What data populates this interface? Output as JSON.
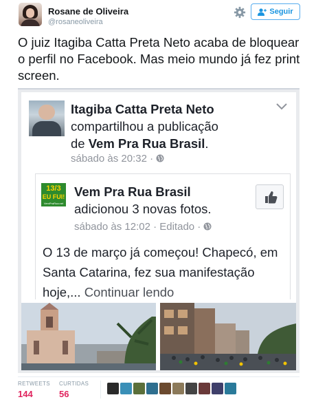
{
  "tweet": {
    "author_name": "Rosane de Oliveira",
    "author_handle": "@rosaneoliveira",
    "follow_label": "Seguir",
    "text": "O juiz Itagiba Catta Preta Neto acaba de bloquear o perfil no Facebook. Mas meio mundo já fez print screen."
  },
  "facebook_post": {
    "poster_name": "Itagiba Catta Preta Neto",
    "action_text": "compartilhou a publicação",
    "action_of": "de",
    "page_name": "Vem Pra Rua Brasil",
    "timestamp": "sábado às 20:32 ·",
    "shared": {
      "logo_line1": "13/3",
      "logo_line2": "EU FUI!",
      "logo_line3": "VemPraRua.net",
      "page_name": "Vem Pra Rua Brasil",
      "subtitle": "adicionou 3 novas fotos.",
      "timestamp": "sábado às 12:02 · Editado ·",
      "body": "O 13 de março já começou! Chapecó, em Santa Catarina, fez sua manifestação hoje,...",
      "more_link": "Continuar lendo"
    }
  },
  "stats": {
    "retweets_label": "RETWEETS",
    "retweets_value": "144",
    "likes_label": "CURTIDAS",
    "likes_value": "56",
    "liker_colors": [
      "#2a2a2a",
      "#3a8fb7",
      "#5b6f3a",
      "#2f6f8f",
      "#6b4a2f",
      "#8c7a5a",
      "#444444",
      "#6a3a3a",
      "#3f3f6a",
      "#2a7a9a"
    ]
  },
  "colors": {
    "accent": "#1b95e0",
    "like_red": "#e0245e",
    "muted": "#8899a6",
    "fb_muted": "#90949c"
  }
}
